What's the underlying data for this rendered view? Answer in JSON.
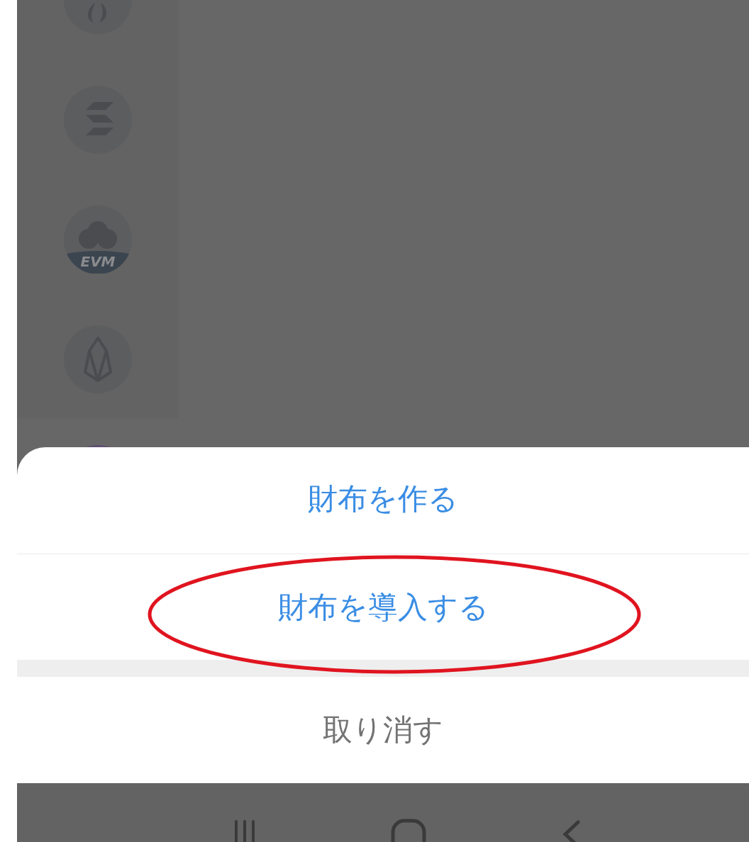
{
  "sidebar": {
    "items": [
      {
        "kind": "flame"
      },
      {
        "kind": "stripes"
      },
      {
        "kind": "evm",
        "label": "EVM"
      },
      {
        "kind": "crystal"
      },
      {
        "kind": "purple"
      }
    ]
  },
  "action_sheet": {
    "options": [
      {
        "label": "財布を作る",
        "circled": false
      },
      {
        "label": "財布を導入する",
        "circled": true
      }
    ],
    "cancel": "取り消す"
  },
  "nav_bar": {
    "buttons": [
      {
        "kind": "recents"
      },
      {
        "kind": "home"
      },
      {
        "kind": "back"
      }
    ]
  }
}
